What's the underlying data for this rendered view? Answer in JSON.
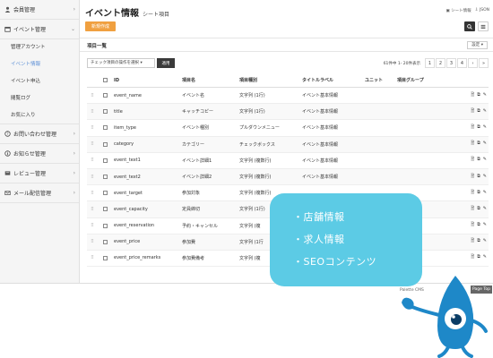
{
  "sidebar": {
    "groups": [
      {
        "label": "会員管理",
        "icon": "user-icon"
      },
      {
        "label": "イベント管理",
        "icon": "calendar-icon"
      },
      {
        "label": "お問い合わせ管理",
        "icon": "question-icon"
      },
      {
        "label": "お知らせ管理",
        "icon": "info-icon"
      },
      {
        "label": "レビュー管理",
        "icon": "review-icon"
      },
      {
        "label": "メール配信管理",
        "icon": "mail-icon"
      }
    ],
    "event_items": [
      "管理アカウント",
      "イベント情報",
      "イベント申込",
      "閲覧ログ",
      "お気に入り"
    ]
  },
  "header": {
    "title": "イベント情報",
    "subtitle": "シート項目",
    "link_sheet": "シート情報",
    "link_json": "JSON",
    "create_label": "新規作成"
  },
  "section": {
    "title": "項目一覧",
    "settings_label": "設定"
  },
  "toolbar": {
    "bulk_select": "チェック項目の操作を選択",
    "apply_label": "適用"
  },
  "pager": {
    "count_text": "61件中 1- 20件表示",
    "pages": [
      "1",
      "2",
      "3",
      "4"
    ]
  },
  "table": {
    "headers": [
      "ID",
      "項目名",
      "項目種別",
      "タイトルラベル",
      "ユニット",
      "項目グループ"
    ],
    "rows": [
      [
        "event_name",
        "イベント名",
        "文字列 (1行)",
        "イベント基本情報"
      ],
      [
        "title",
        "キャッチコピー",
        "文字列 (1行)",
        "イベント基本情報"
      ],
      [
        "item_type",
        "イベント種別",
        "プルダウンメニュー",
        "イベント基本情報"
      ],
      [
        "category",
        "カテゴリー",
        "チェックボックス",
        "イベント基本情報"
      ],
      [
        "event_text1",
        "イベント詳細1",
        "文字列 (複数行)",
        "イベント基本情報"
      ],
      [
        "event_text2",
        "イベント詳細2",
        "文字列 (複数行)",
        "イベント基本情報"
      ],
      [
        "event_target",
        "参加対象",
        "文字列 (複数行)",
        ""
      ],
      [
        "event_capacity",
        "定員締切",
        "文字列 (1行)",
        ""
      ],
      [
        "event_reservation",
        "予約・キャンセル",
        "文字列 (複",
        ""
      ],
      [
        "event_price",
        "参加費",
        "文字列 (1行",
        ""
      ],
      [
        "event_price_remarks",
        "参加費備考",
        "文字列 (複",
        ""
      ]
    ]
  },
  "footer": {
    "text": "Palette CMS",
    "page_top": "Page Top"
  },
  "promo": {
    "items": [
      "・店舗情報",
      "・求人情報",
      "・SEOコンテンツ"
    ]
  },
  "colors": {
    "accent_orange": "#f0a040",
    "promo_blue": "#5ccbe5",
    "mascot_blue": "#1e88c8",
    "active_link": "#5c8fd6"
  }
}
